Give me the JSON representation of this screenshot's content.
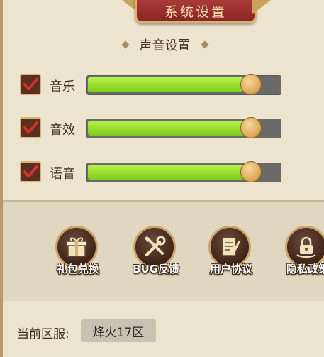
{
  "title": "系统设置",
  "section_title": "声音设置",
  "sliders": [
    {
      "label": "音乐",
      "checked": true,
      "level": 0.85
    },
    {
      "label": "音效",
      "checked": true,
      "level": 0.85
    },
    {
      "label": "语音",
      "checked": true,
      "level": 0.85
    }
  ],
  "actions": [
    {
      "label": "礼包兑换",
      "icon": "gift-icon"
    },
    {
      "label": "BUG反馈",
      "icon": "tools-icon"
    },
    {
      "label": "用户协议",
      "icon": "document-icon"
    },
    {
      "label": "隐私政策",
      "icon": "lock-icon"
    }
  ],
  "server": {
    "label": "当前区服:",
    "value": "烽火17区"
  },
  "colors": {
    "accent_green": "#9ae031",
    "banner_red": "#9b302e",
    "gold": "#d6b478"
  }
}
